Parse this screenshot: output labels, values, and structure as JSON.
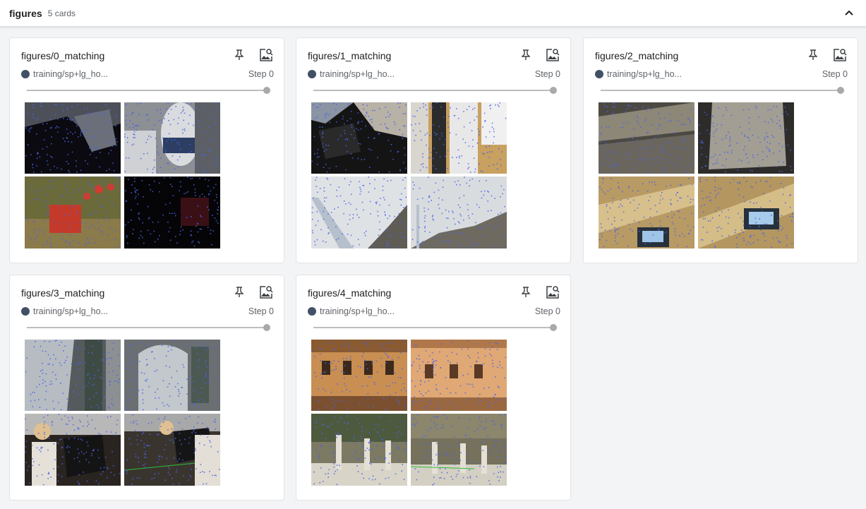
{
  "header": {
    "group_name": "figures",
    "card_count": "5 cards"
  },
  "cards": [
    {
      "title": "figures/0_matching",
      "run_name": "training/sp+lg_ho...",
      "step_label": "Step 0",
      "run_color": "#425066",
      "step_fraction": 1.0
    },
    {
      "title": "figures/1_matching",
      "run_name": "training/sp+lg_ho...",
      "step_label": "Step 0",
      "run_color": "#425066",
      "step_fraction": 1.0
    },
    {
      "title": "figures/2_matching",
      "run_name": "training/sp+lg_ho...",
      "step_label": "Step 0",
      "run_color": "#425066",
      "step_fraction": 1.0
    },
    {
      "title": "figures/3_matching",
      "run_name": "training/sp+lg_ho...",
      "step_label": "Step 0",
      "run_color": "#425066",
      "step_fraction": 1.0
    },
    {
      "title": "figures/4_matching",
      "run_name": "training/sp+lg_ho...",
      "step_label": "Step 0",
      "run_color": "#425066",
      "step_fraction": 1.0
    }
  ],
  "icons": {
    "collapse": "chevron-up-icon",
    "pin": "pin-icon",
    "image_viewer": "image-search-icon"
  },
  "colors": {
    "keypoint": "#4a63e8",
    "match_line": "#2fbf3a",
    "thumb": "#a9a9a9",
    "run_dot": "#425066"
  }
}
